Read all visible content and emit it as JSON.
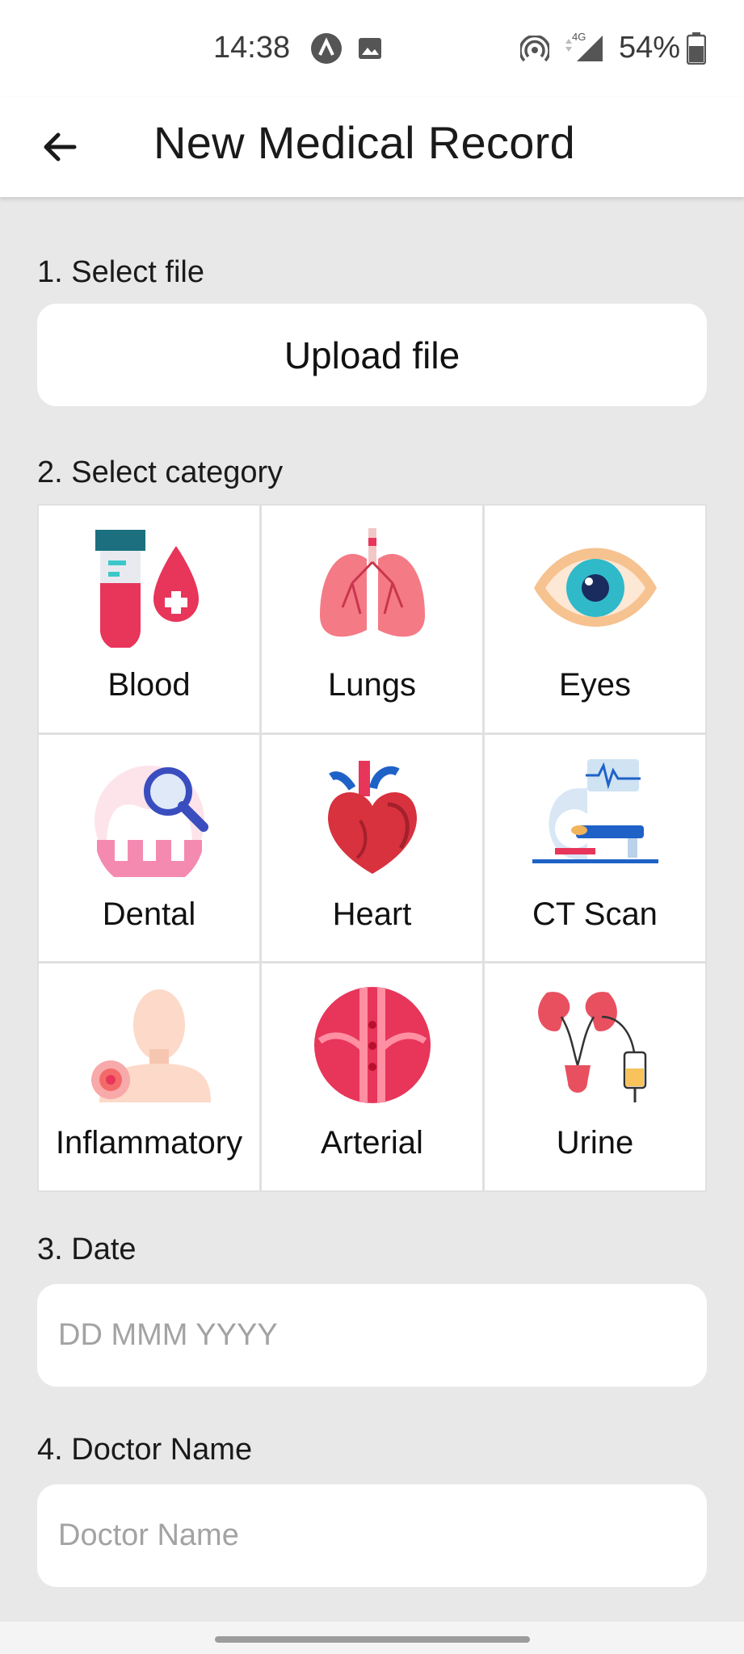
{
  "status_bar": {
    "time": "14:38",
    "network_label": "4G",
    "battery_text": "54%",
    "icons": [
      "app-notification-icon",
      "image-icon",
      "hotspot-icon",
      "signal-icon",
      "battery-icon"
    ]
  },
  "app_bar": {
    "title": "New Medical Record",
    "back_icon": "arrow-left-icon"
  },
  "form": {
    "step1_label": "1. Select file",
    "upload_label": "Upload file",
    "step2_label": "2. Select category",
    "categories": [
      {
        "label": "Blood",
        "icon": "blood-icon"
      },
      {
        "label": "Lungs",
        "icon": "lungs-icon"
      },
      {
        "label": "Eyes",
        "icon": "eye-icon"
      },
      {
        "label": "Dental",
        "icon": "tooth-icon"
      },
      {
        "label": "Heart",
        "icon": "heart-icon"
      },
      {
        "label": "CT Scan",
        "icon": "ct-scanner-icon"
      },
      {
        "label": "Inflammatory",
        "icon": "inflammation-icon"
      },
      {
        "label": "Arterial",
        "icon": "artery-icon"
      },
      {
        "label": "Urine",
        "icon": "kidney-icon"
      }
    ],
    "step3_label": "3. Date",
    "date_placeholder": "DD MMM YYYY",
    "step4_label": "4. Doctor Name",
    "doctor_placeholder": "Doctor Name"
  },
  "colors": {
    "background": "#e8e8e8",
    "card": "#ffffff",
    "placeholder": "#a3a3a3",
    "accent_red": "#e63950",
    "accent_teal": "#2fb9c9"
  }
}
